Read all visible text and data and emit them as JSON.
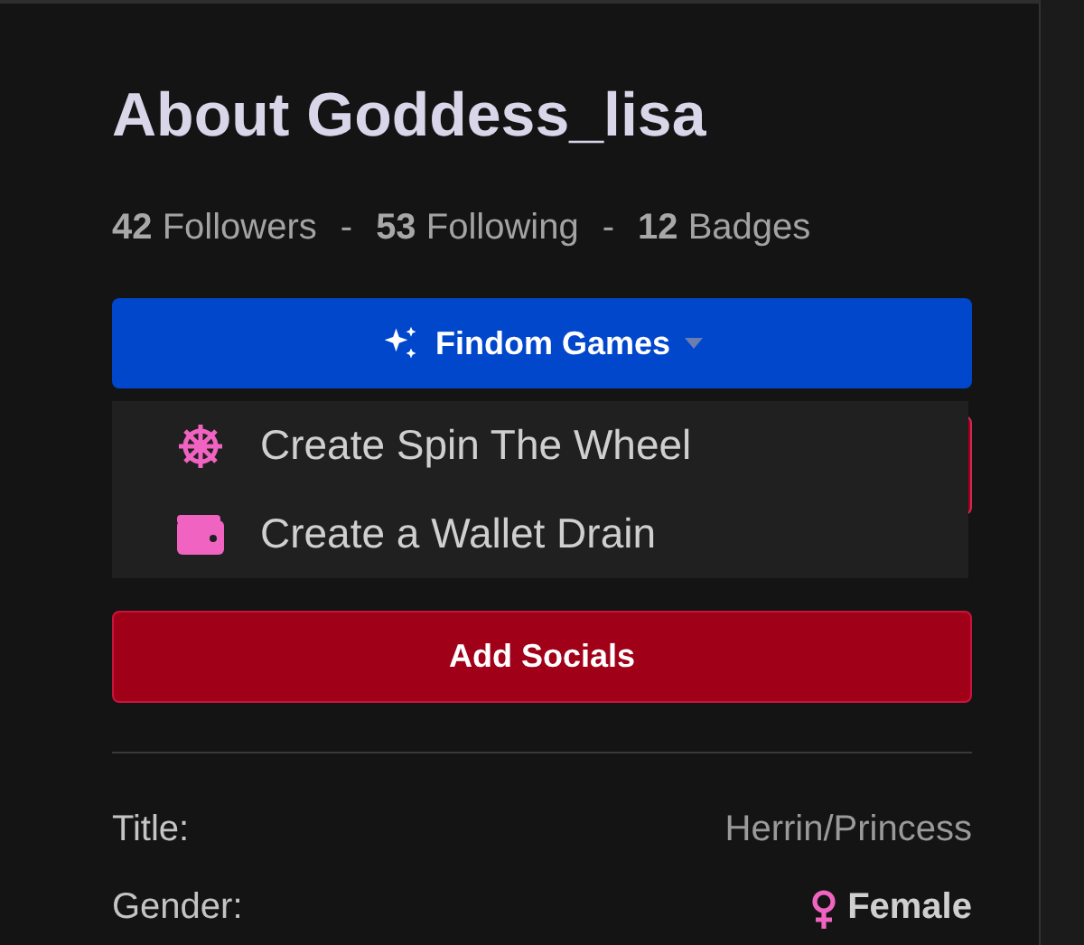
{
  "heading": "About Goddess_lisa",
  "stats": [
    {
      "kind": "stat",
      "count": "42",
      "label": "Followers"
    },
    {
      "kind": "sep",
      "text": "-"
    },
    {
      "kind": "stat",
      "count": "53",
      "label": "Following"
    },
    {
      "kind": "sep",
      "text": "-"
    },
    {
      "kind": "stat",
      "count": "12",
      "label": "Badges"
    }
  ],
  "games_menu": {
    "label": "Findom Games",
    "expanded": true,
    "items": [
      {
        "label": "Create Spin The Wheel"
      },
      {
        "label": "Create a Wallet Drain"
      }
    ]
  },
  "add_socials": "Add Socials",
  "details": [
    {
      "kind": "text",
      "label": "Title:",
      "value": "Herrin/Princess"
    },
    {
      "kind": "gender",
      "label": "Gender:",
      "value": "Female"
    }
  ]
}
